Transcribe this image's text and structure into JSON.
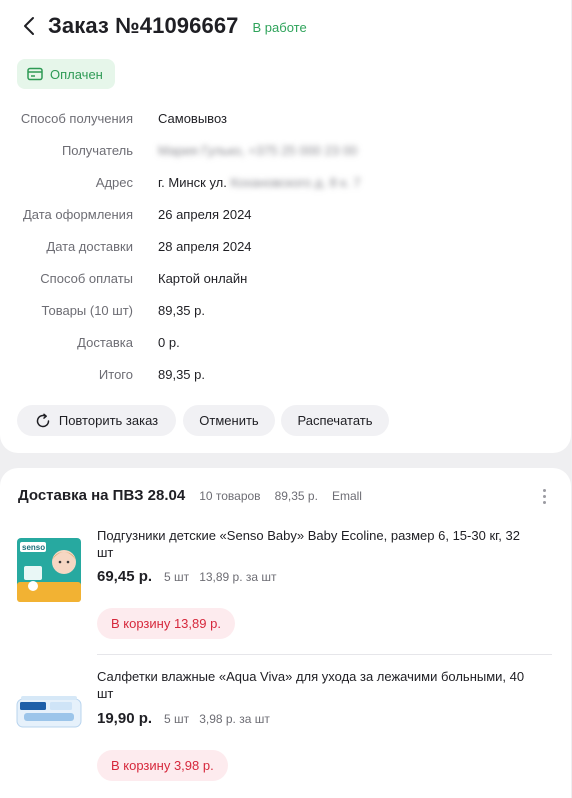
{
  "order": {
    "title": "Заказ №41096667",
    "status": "В работе",
    "payment_badge": "Оплачен"
  },
  "details": [
    {
      "label": "Способ получения",
      "value": "Самовывоз"
    },
    {
      "label": "Получатель",
      "value": "Мария Гулько, +375 25 000 23 00"
    },
    {
      "label": "Адрес",
      "value_prefix": "г. Минск ул. ",
      "value_blurred": "Кохановского д. 8 к. 7"
    },
    {
      "label": "Дата оформления",
      "value": "26 апреля 2024"
    },
    {
      "label": "Дата доставки",
      "value": "28 апреля 2024"
    },
    {
      "label": "Способ оплаты",
      "value": "Картой онлайн"
    },
    {
      "label": "Товары (10 шт)",
      "value": "89,35 р."
    },
    {
      "label": "Доставка",
      "value": "0 р."
    },
    {
      "label": "Итого",
      "value": "89,35 р."
    }
  ],
  "actions": {
    "repeat": "Повторить заказ",
    "cancel": "Отменить",
    "print": "Распечатать"
  },
  "delivery": {
    "title": "Доставка на ПВЗ 28.04",
    "count": "10 товаров",
    "sum": "89,35 р.",
    "provider": "Emall"
  },
  "products": [
    {
      "name": "Подгузники детские «Senso Baby» Baby Ecoline, размер 6, 15-30 кг, 32 шт",
      "price": "69,45 р.",
      "qty": "5 шт",
      "unit_price": "13,89 р. за шт",
      "cart_label": "В корзину 13,89 р.",
      "image_text": "senso"
    },
    {
      "name": "Салфетки влажные «Aqua Viva» для ухода за лежачими больными, 40 шт",
      "price": "19,90 р.",
      "qty": "5 шт",
      "unit_price": "3,98 р. за шт",
      "cart_label": "В корзину 3,98 р."
    }
  ],
  "colors": {
    "accent_green": "#2fa35b",
    "cart_red": "#d6283c",
    "cart_bg": "#fdebee",
    "badge_bg": "#e6f6ea"
  }
}
